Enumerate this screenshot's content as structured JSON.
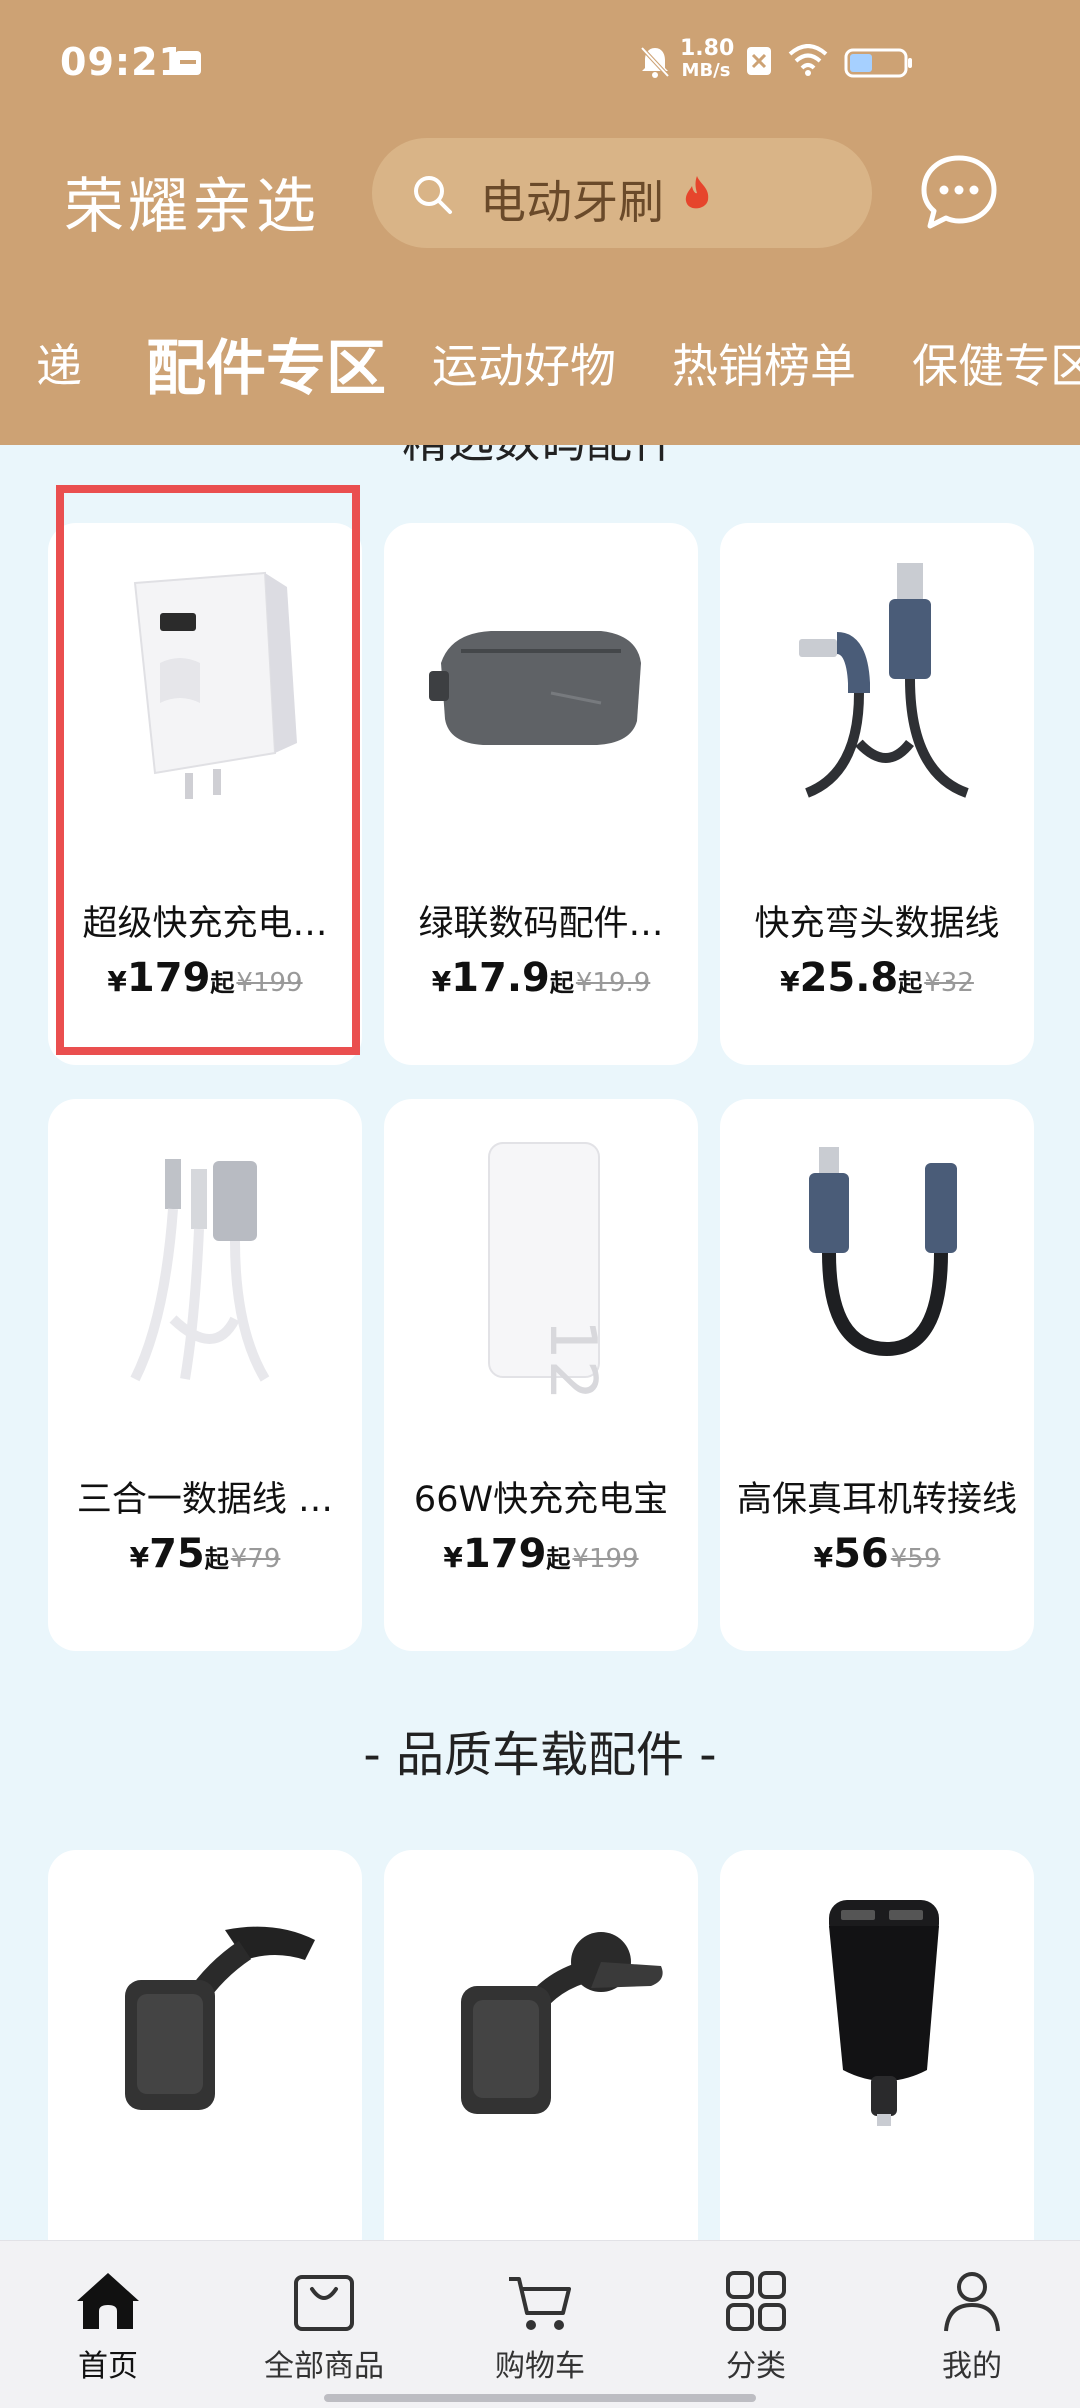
{
  "status_bar": {
    "time": "09:21",
    "net_speed_value": "1.80",
    "net_speed_unit": "MB/s",
    "icons": [
      "calendar-icon",
      "bell-off-icon",
      "sim-off-icon",
      "wifi-icon",
      "battery-icon"
    ]
  },
  "app": {
    "title": "荣耀亲选",
    "search_text": "电动牙刷",
    "search_icon": "search-icon",
    "fire_icon": "fire-icon",
    "chat_icon": "chat-icon"
  },
  "tabs": [
    {
      "label": "递",
      "active": false
    },
    {
      "label": "配件专区",
      "active": true
    },
    {
      "label": "运动好物",
      "active": false
    },
    {
      "label": "热销榜单",
      "active": false
    },
    {
      "label": "保健专区",
      "active": false
    }
  ],
  "section_partial_title": "精选数码配件",
  "products": [
    {
      "name": "超级快充充电…",
      "price_symbol": "¥",
      "price": "179",
      "suffix": "起",
      "old_price": "¥199",
      "icon": "charger-image"
    },
    {
      "name": "绿联数码配件…",
      "price_symbol": "¥",
      "price": "17.9",
      "suffix": "起",
      "old_price": "¥19.9",
      "icon": "pouch-image"
    },
    {
      "name": "快充弯头数据线",
      "price_symbol": "¥",
      "price": "25.8",
      "suffix": "起",
      "old_price": "¥32",
      "icon": "cable-image"
    },
    {
      "name": "三合一数据线 …",
      "price_symbol": "¥",
      "price": "75",
      "suffix": "起",
      "old_price": "¥79",
      "icon": "three-in-one-cable-image"
    },
    {
      "name": "66W快充充电宝",
      "price_symbol": "¥",
      "price": "179",
      "suffix": "起",
      "old_price": "¥199",
      "icon": "power-bank-image"
    },
    {
      "name": "高保真耳机转接线",
      "price_symbol": "¥",
      "price": "56",
      "suffix": "",
      "old_price": "¥59",
      "icon": "audio-adapter-image"
    }
  ],
  "section2_title": "- 品质车载配件 -",
  "car_products": [
    {
      "icon": "car-phone-holder-image"
    },
    {
      "icon": "car-phone-holder-image"
    },
    {
      "icon": "car-charger-image"
    }
  ],
  "bottom_nav": [
    {
      "label": "首页",
      "icon": "home-icon",
      "active": true
    },
    {
      "label": "全部商品",
      "icon": "shopping-bag-icon",
      "active": false
    },
    {
      "label": "购物车",
      "icon": "cart-icon",
      "active": false
    },
    {
      "label": "分类",
      "icon": "grid-icon",
      "active": false
    },
    {
      "label": "我的",
      "icon": "user-icon",
      "active": false
    }
  ],
  "colors": {
    "header_bg": "#cda274",
    "search_bg": "#d9b487",
    "content_bg": "#eaf6fb",
    "highlight": "#ea4f4f"
  }
}
